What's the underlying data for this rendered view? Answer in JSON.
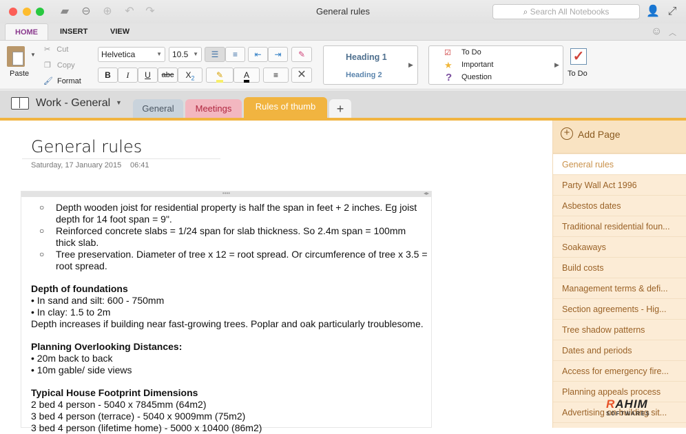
{
  "window": {
    "title": "General rules",
    "search_placeholder": "Search All Notebooks"
  },
  "ribbon_tabs": [
    "HOME",
    "INSERT",
    "VIEW"
  ],
  "clipboard": {
    "paste": "Paste",
    "cut": "Cut",
    "copy": "Copy",
    "format": "Format"
  },
  "font": {
    "family": "Helvetica",
    "size": "10.5"
  },
  "styles": {
    "h1": "Heading 1",
    "h2": "Heading 2"
  },
  "tags": {
    "items": [
      "To Do",
      "Important",
      "Question"
    ],
    "todo_button": "To Do"
  },
  "notebook": {
    "name": "Work - General",
    "sections": [
      {
        "label": "General",
        "color": "#c9d3dc"
      },
      {
        "label": "Meetings",
        "color": "#f3b7c0"
      },
      {
        "label": "Rules of thumb",
        "color": "#f1b440"
      }
    ],
    "add_section": "+"
  },
  "sidebar": {
    "add_page": "Add Page",
    "pages": [
      "General rules",
      "Party Wall Act 1996",
      "Asbestos dates",
      "Traditional residential foun...",
      "Soakaways",
      "Build costs",
      "Management terms & defi...",
      "Section agreements - Hig...",
      "Tree shadow patterns",
      "Dates and periods",
      "Access for emergency fire...",
      "Planning appeals process",
      "Advertising on building sit..."
    ]
  },
  "page": {
    "title": "General rules",
    "date": "Saturday, 17 January 2015",
    "time": "06:41",
    "bullets": [
      [
        "Depth wooden joist for residential property is half the span in feet + 2 inches. Eg joist",
        "depth for 14 foot span = 9\"."
      ],
      [
        "Reinforced concrete slabs = 1/24 span for slab thickness. So 2.4m span = 100mm",
        "thick slab."
      ],
      [
        "Tree preservation. Diameter of tree x 12 = root spread. Or circumference of tree x 3.5 =",
        "root spread."
      ]
    ],
    "sections": [
      {
        "heading": "Depth of foundations",
        "lines": [
          "• In sand and silt: 600 - 750mm",
          "• In clay: 1.5 to 2m",
          "Depth increases if building near fast-growing trees. Poplar and oak particularly troublesome."
        ]
      },
      {
        "heading": "Planning Overlooking Distances:",
        "lines": [
          "• 20m back to back",
          "• 10m gable/ side views"
        ]
      },
      {
        "heading": "Typical House Footprint Dimensions",
        "lines": [
          "2 bed 4 person - 5040 x 7845mm (64m2)",
          "3 bed 4 person (terrace) - 5040 x 9009mm (75m2)",
          "3 bed 4 person (lifetime home) - 5000 x 10400 (86m2)"
        ]
      }
    ]
  },
  "watermark": "RAHIM SOFTWARES"
}
